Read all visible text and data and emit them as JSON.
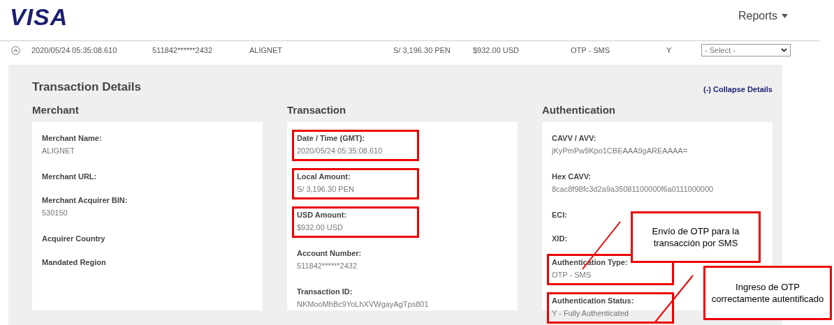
{
  "header": {
    "logo": "VISA",
    "menu": "Reports"
  },
  "transaction_row": {
    "expanded": true,
    "cells": [
      "2020/05/24 05:35:08.610",
      "511842******2432",
      "ALIGNET",
      "S/ 3,196.30 PEN",
      "$932.00 USD",
      "OTP - SMS",
      "Y"
    ],
    "action_select": "- Select -"
  },
  "details": {
    "title": "Transaction Details",
    "collapse_link": "(-) Collapse Details",
    "sections": [
      {
        "heading": "Merchant",
        "fields": [
          {
            "label": "Merchant Name:",
            "value": "ALIGNET",
            "highlighted": false
          },
          {
            "label": "Merchant URL:",
            "highlighted": false
          },
          {
            "label": "Merchant Acquirer BIN:",
            "value": "530150",
            "highlighted": false
          },
          {
            "label": "Acquirer Country",
            "highlighted": false
          },
          {
            "label": "Mandated Region",
            "highlighted": false
          }
        ]
      },
      {
        "heading": "Transaction",
        "fields": [
          {
            "label": "Date / Time (GMT):",
            "value": "2020/05/24 05:35:08.610",
            "highlighted": true
          },
          {
            "label": "Local Amount:",
            "value": "S/ 3,196.30 PEN",
            "highlighted": true
          },
          {
            "label": "USD Amount:",
            "value": "$932.00 USD",
            "highlighted": true
          },
          {
            "label": "Account Number:",
            "value": "511842******2432",
            "highlighted": false
          },
          {
            "label": "Transaction ID:",
            "value": "NKMooMhBc9YoLhXVWgayAgTps801",
            "highlighted": false
          }
        ]
      },
      {
        "heading": "Authentication",
        "fields": [
          {
            "label": "CAVV / AVV:",
            "value": "jKyPmPw9Kpo1CBEAAA9gAREAAAA=",
            "highlighted": false
          },
          {
            "label": "Hex CAVV:",
            "value": "8cac8f98fc3d2a9a35081100000f6a0111000000",
            "highlighted": false
          },
          {
            "label": "ECI:",
            "highlighted": false
          },
          {
            "label": "XID:",
            "highlighted": false
          },
          {
            "label": "Authentication Type:",
            "value": "OTP - SMS",
            "highlighted": true
          },
          {
            "label": "Authentication Status:",
            "value": "Y - Fully Authenticated",
            "highlighted": true
          }
        ]
      }
    ]
  },
  "callouts": [
    {
      "text": "Envío de OTP para la transacción por SMS"
    },
    {
      "text": "Ingreso de OTP correctamente autentificado"
    }
  ]
}
